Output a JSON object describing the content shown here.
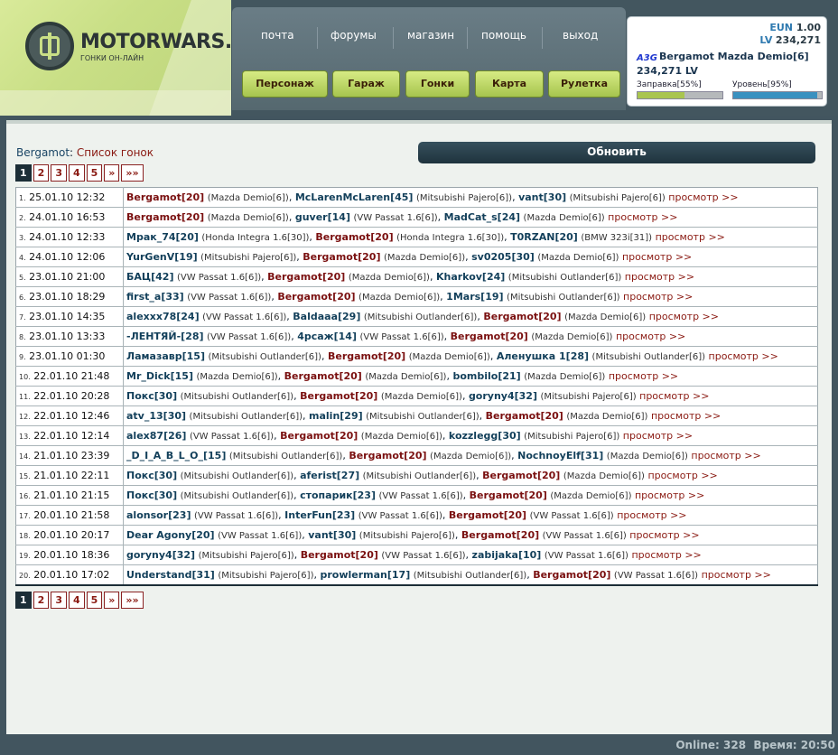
{
  "logo": {
    "title": "MOTORWARS.RU",
    "subtitle": "ГОНКИ ОН-ЛАЙН"
  },
  "nav": {
    "top": [
      "почта",
      "форумы",
      "магазин",
      "помощь",
      "выход"
    ],
    "buttons": [
      "Персонаж",
      "Гараж",
      "Гонки",
      "Карта",
      "Рулетка"
    ]
  },
  "user": {
    "eun_label": "EUN",
    "eun_value": "1.00",
    "lv_label": "LV",
    "lv_value": "234,271",
    "clan_tag": "A3G",
    "name_car": "Bergamot Mazda Demio[6]",
    "money": "234,271 LV",
    "fuel_label": "Заправка[55%]",
    "fuel_level": 55,
    "level_label": "Уровень[95%]",
    "level_level": 95
  },
  "page": {
    "user": "Bergamot",
    "separator": ": ",
    "title": "Список гонок",
    "refresh": "Обновить"
  },
  "pager": [
    "1",
    "2",
    "3",
    "4",
    "5",
    "»",
    "»»"
  ],
  "view_label": "просмотр >>",
  "races": [
    {
      "n": "1.",
      "date": "25.01.10 12:32",
      "parts": [
        [
          "Bergamot",
          "[20]",
          "(Mazda Demio[6])"
        ],
        [
          "McLarenMcLaren",
          "[45]",
          "(Mitsubishi Pajero[6])"
        ],
        [
          "vant",
          "[30]",
          "(Mitsubishi Pajero[6])"
        ]
      ]
    },
    {
      "n": "2.",
      "date": "24.01.10 16:53",
      "parts": [
        [
          "Bergamot",
          "[20]",
          "(Mazda Demio[6])"
        ],
        [
          "guver",
          "[14]",
          "(VW Passat 1.6[6])"
        ],
        [
          "MadCat_s",
          "[24]",
          "(Mazda Demio[6])"
        ]
      ]
    },
    {
      "n": "3.",
      "date": "24.01.10 12:33",
      "parts": [
        [
          "Мрак_74",
          "[20]",
          "(Honda Integra 1.6[30])"
        ],
        [
          "Bergamot",
          "[20]",
          "(Honda Integra 1.6[30])"
        ],
        [
          "T0RZAN",
          "[20]",
          "(BMW 323i[31])"
        ]
      ]
    },
    {
      "n": "4.",
      "date": "24.01.10 12:06",
      "parts": [
        [
          "YurGenV",
          "[19]",
          "(Mitsubishi Pajero[6])"
        ],
        [
          "Bergamot",
          "[20]",
          "(Mazda Demio[6])"
        ],
        [
          "sv0205",
          "[30]",
          "(Mazda Demio[6])"
        ]
      ]
    },
    {
      "n": "5.",
      "date": "23.01.10 21:00",
      "parts": [
        [
          "БАЦ",
          "[42]",
          "(VW Passat 1.6[6])"
        ],
        [
          "Bergamot",
          "[20]",
          "(Mazda Demio[6])"
        ],
        [
          "Kharkov",
          "[24]",
          "(Mitsubishi Outlander[6])"
        ]
      ]
    },
    {
      "n": "6.",
      "date": "23.01.10 18:29",
      "parts": [
        [
          "first_a",
          "[33]",
          "(VW Passat 1.6[6])"
        ],
        [
          "Bergamot",
          "[20]",
          "(Mazda Demio[6])"
        ],
        [
          "1Mars",
          "[19]",
          "(Mitsubishi Outlander[6])"
        ]
      ]
    },
    {
      "n": "7.",
      "date": "23.01.10 14:35",
      "parts": [
        [
          "alexxx78",
          "[24]",
          "(VW Passat 1.6[6])"
        ],
        [
          "Baldaaa",
          "[29]",
          "(Mitsubishi Outlander[6])"
        ],
        [
          "Bergamot",
          "[20]",
          "(Mazda Demio[6])"
        ]
      ]
    },
    {
      "n": "8.",
      "date": "23.01.10 13:33",
      "parts": [
        [
          "-ЛЕНТЯЙ-",
          "[28]",
          "(VW Passat 1.6[6])"
        ],
        [
          "4рсаж",
          "[14]",
          "(VW Passat 1.6[6])"
        ],
        [
          "Bergamot",
          "[20]",
          "(Mazda Demio[6])"
        ]
      ]
    },
    {
      "n": "9.",
      "date": "23.01.10 01:30",
      "parts": [
        [
          "Ламазавр",
          "[15]",
          "(Mitsubishi Outlander[6])"
        ],
        [
          "Bergamot",
          "[20]",
          "(Mazda Demio[6])"
        ],
        [
          "Аленушка 1",
          "[28]",
          "(Mitsubishi Outlander[6])"
        ]
      ]
    },
    {
      "n": "10.",
      "date": "22.01.10 21:48",
      "parts": [
        [
          "Mr_Dick",
          "[15]",
          "(Mazda Demio[6])"
        ],
        [
          "Bergamot",
          "[20]",
          "(Mazda Demio[6])"
        ],
        [
          "bombilo",
          "[21]",
          "(Mazda Demio[6])"
        ]
      ]
    },
    {
      "n": "11.",
      "date": "22.01.10 20:28",
      "parts": [
        [
          "Покс",
          "[30]",
          "(Mitsubishi Outlander[6])"
        ],
        [
          "Bergamot",
          "[20]",
          "(Mazda Demio[6])"
        ],
        [
          "goryny4",
          "[32]",
          "(Mitsubishi Pajero[6])"
        ]
      ]
    },
    {
      "n": "12.",
      "date": "22.01.10 12:46",
      "parts": [
        [
          "atv_13",
          "[30]",
          "(Mitsubishi Outlander[6])"
        ],
        [
          "malin",
          "[29]",
          "(Mitsubishi Outlander[6])"
        ],
        [
          "Bergamot",
          "[20]",
          "(Mazda Demio[6])"
        ]
      ]
    },
    {
      "n": "13.",
      "date": "22.01.10 12:14",
      "parts": [
        [
          "alex87",
          "[26]",
          "(VW Passat 1.6[6])"
        ],
        [
          "Bergamot",
          "[20]",
          "(Mazda Demio[6])"
        ],
        [
          "kozzlegg",
          "[30]",
          "(Mitsubishi Pajero[6])"
        ]
      ]
    },
    {
      "n": "14.",
      "date": "21.01.10 23:39",
      "parts": [
        [
          "_D_I_A_B_L_O_",
          "[15]",
          "(Mitsubishi Outlander[6])"
        ],
        [
          "Bergamot",
          "[20]",
          "(Mazda Demio[6])"
        ],
        [
          "NochnoyElf",
          "[31]",
          "(Mazda Demio[6])"
        ]
      ]
    },
    {
      "n": "15.",
      "date": "21.01.10 22:11",
      "parts": [
        [
          "Покс",
          "[30]",
          "(Mitsubishi Outlander[6])"
        ],
        [
          "aferist",
          "[27]",
          "(Mitsubishi Outlander[6])"
        ],
        [
          "Bergamot",
          "[20]",
          "(Mazda Demio[6])"
        ]
      ]
    },
    {
      "n": "16.",
      "date": "21.01.10 21:15",
      "parts": [
        [
          "Покс",
          "[30]",
          "(Mitsubishi Outlander[6])"
        ],
        [
          "стопарик",
          "[23]",
          "(VW Passat 1.6[6])"
        ],
        [
          "Bergamot",
          "[20]",
          "(Mazda Demio[6])"
        ]
      ]
    },
    {
      "n": "17.",
      "date": "20.01.10 21:58",
      "parts": [
        [
          "alonsor",
          "[23]",
          "(VW Passat 1.6[6])"
        ],
        [
          "InterFun",
          "[23]",
          "(VW Passat 1.6[6])"
        ],
        [
          "Bergamot",
          "[20]",
          "(VW Passat 1.6[6])"
        ]
      ]
    },
    {
      "n": "18.",
      "date": "20.01.10 20:17",
      "parts": [
        [
          "Dear Agony",
          "[20]",
          "(VW Passat 1.6[6])"
        ],
        [
          "vant",
          "[30]",
          "(Mitsubishi Pajero[6])"
        ],
        [
          "Bergamot",
          "[20]",
          "(VW Passat 1.6[6])"
        ]
      ]
    },
    {
      "n": "19.",
      "date": "20.01.10 18:36",
      "parts": [
        [
          "goryny4",
          "[32]",
          "(Mitsubishi Pajero[6])"
        ],
        [
          "Bergamot",
          "[20]",
          "(VW Passat 1.6[6])"
        ],
        [
          "zabijaka",
          "[10]",
          "(VW Passat 1.6[6])"
        ]
      ]
    },
    {
      "n": "20.",
      "date": "20.01.10 17:02",
      "parts": [
        [
          "Understand",
          "[31]",
          "(Mitsubishi Pajero[6])"
        ],
        [
          "prowlerman",
          "[17]",
          "(Mitsubishi Outlander[6])"
        ],
        [
          "Bergamot",
          "[20]",
          "(VW Passat 1.6[6])"
        ]
      ]
    }
  ],
  "status": {
    "online_label": "Online:",
    "online": "328",
    "time_label": "Время:",
    "time": "20:50"
  },
  "colors": {
    "accent": "#1c2e37",
    "link": "#8a1a12",
    "player": "#123f5a",
    "self": "#7a1010",
    "fuel": "#a9c54f",
    "level": "#3a91c0"
  }
}
